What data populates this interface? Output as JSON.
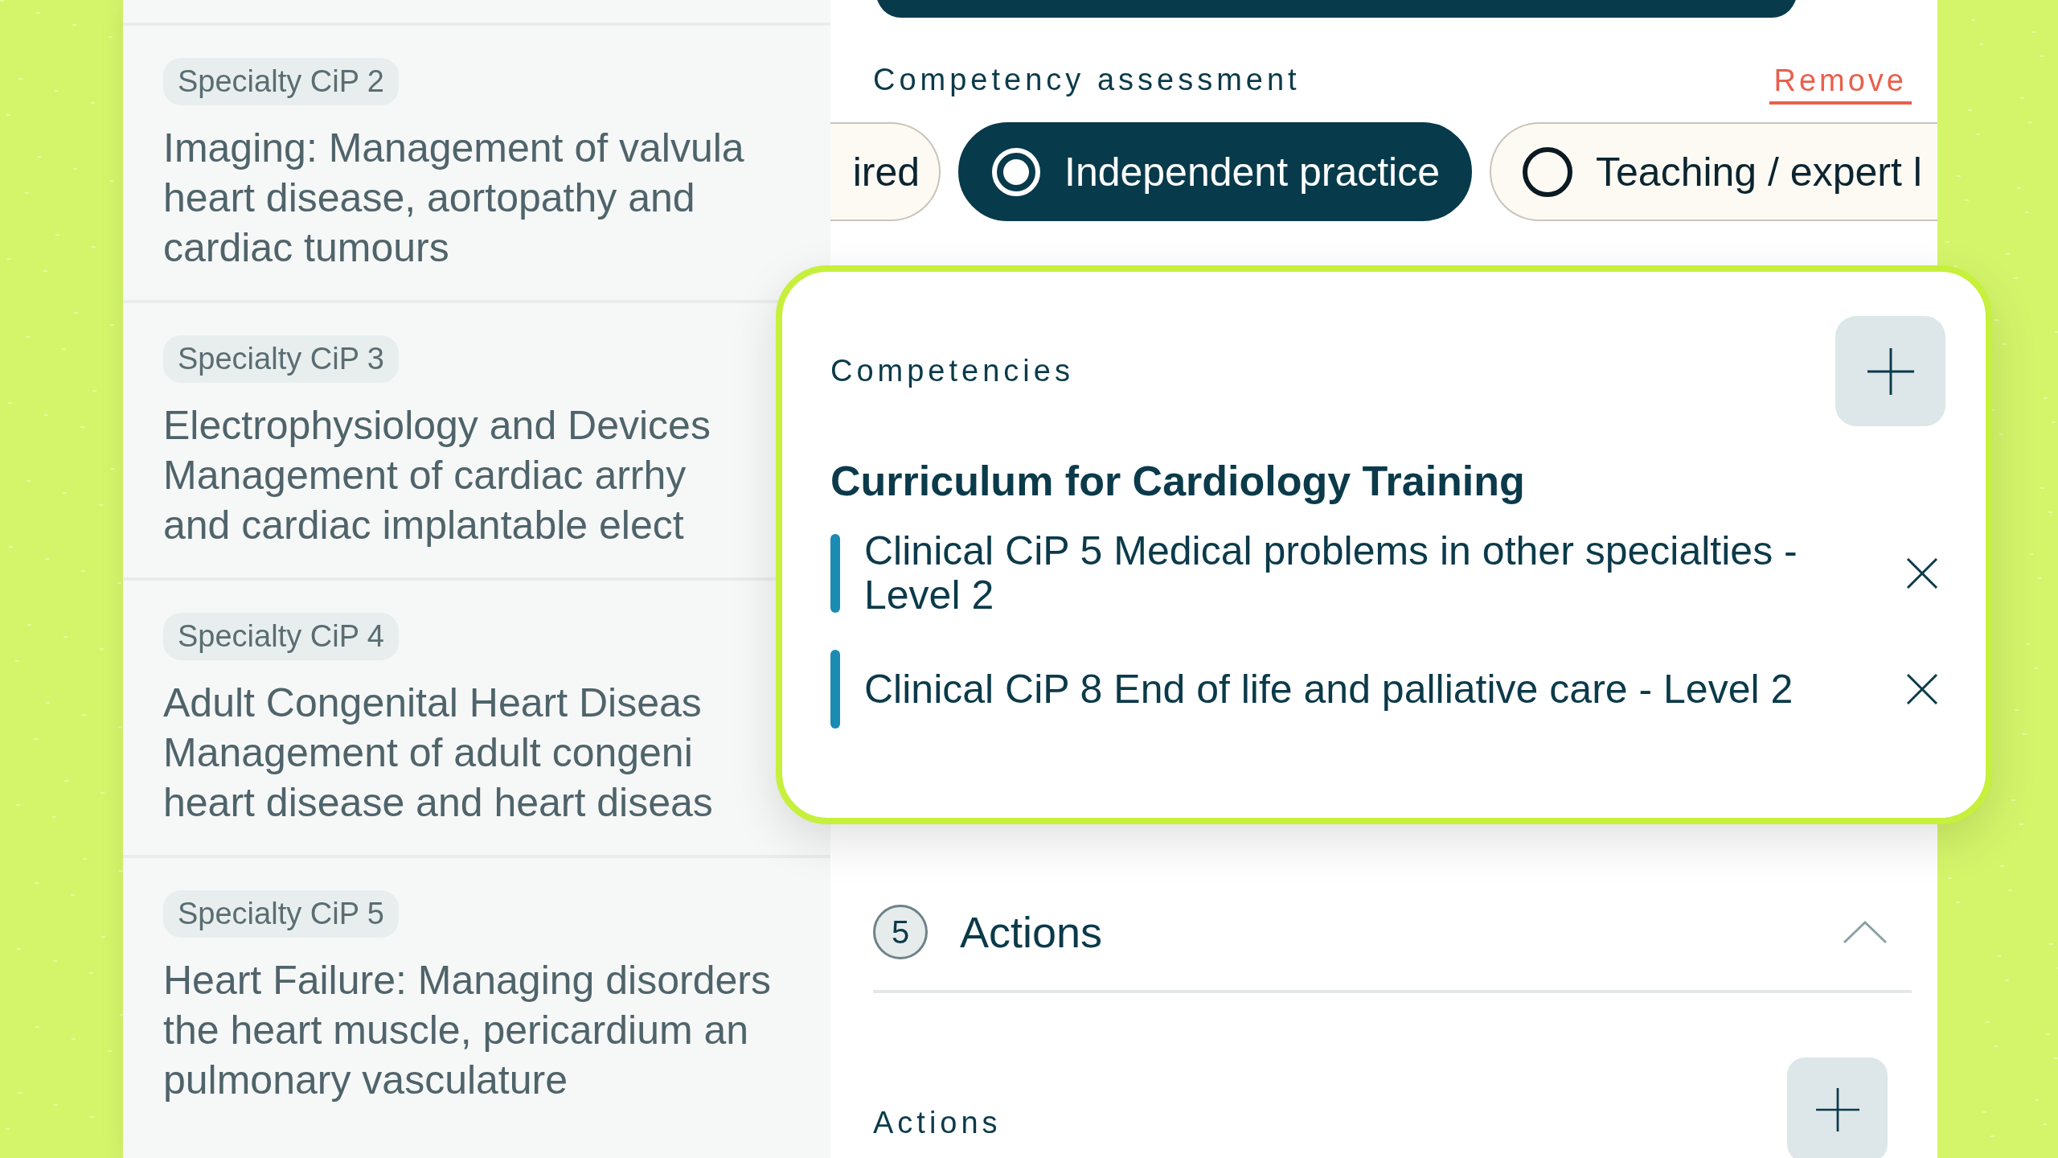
{
  "cip_list": [
    {
      "tag": "Specialty CiP 2",
      "lines": [
        "Imaging: Management of valvula",
        "heart disease, aortopathy and",
        "cardiac tumours"
      ]
    },
    {
      "tag": "Specialty CiP 3",
      "lines": [
        "Electrophysiology and Devices",
        "Management of cardiac arrhy",
        "and cardiac implantable elect"
      ]
    },
    {
      "tag": "Specialty CiP 4",
      "lines": [
        "Adult Congenital Heart Diseas",
        "Management of adult congeni",
        "heart disease and heart diseas"
      ]
    },
    {
      "tag": "Specialty CiP 5",
      "lines": [
        "Heart Failure: Managing disorders",
        "the heart muscle, pericardium an",
        "pulmonary vasculature"
      ]
    }
  ],
  "assessment": {
    "label": "Competency assessment",
    "remove": "Remove",
    "options": [
      {
        "label": "ired",
        "kind": "partial",
        "selected": false
      },
      {
        "label": "Independent practice",
        "kind": "radio",
        "selected": true
      },
      {
        "label": "Teaching / expert l",
        "kind": "radio",
        "selected": false
      }
    ]
  },
  "competencies": {
    "title": "Competencies",
    "curriculum": "Curriculum for Cardiology Training",
    "items": [
      {
        "text": "Clinical CiP 5 Medical problems in other specialties - Level 2",
        "color": "#1a8cb4"
      },
      {
        "text": "Clinical CiP 8 End of life and palliative care - Level 2",
        "color": "#1a8cb4"
      }
    ]
  },
  "actions_section": {
    "number": "5",
    "title": "Actions",
    "expanded": true,
    "label": "Actions"
  }
}
